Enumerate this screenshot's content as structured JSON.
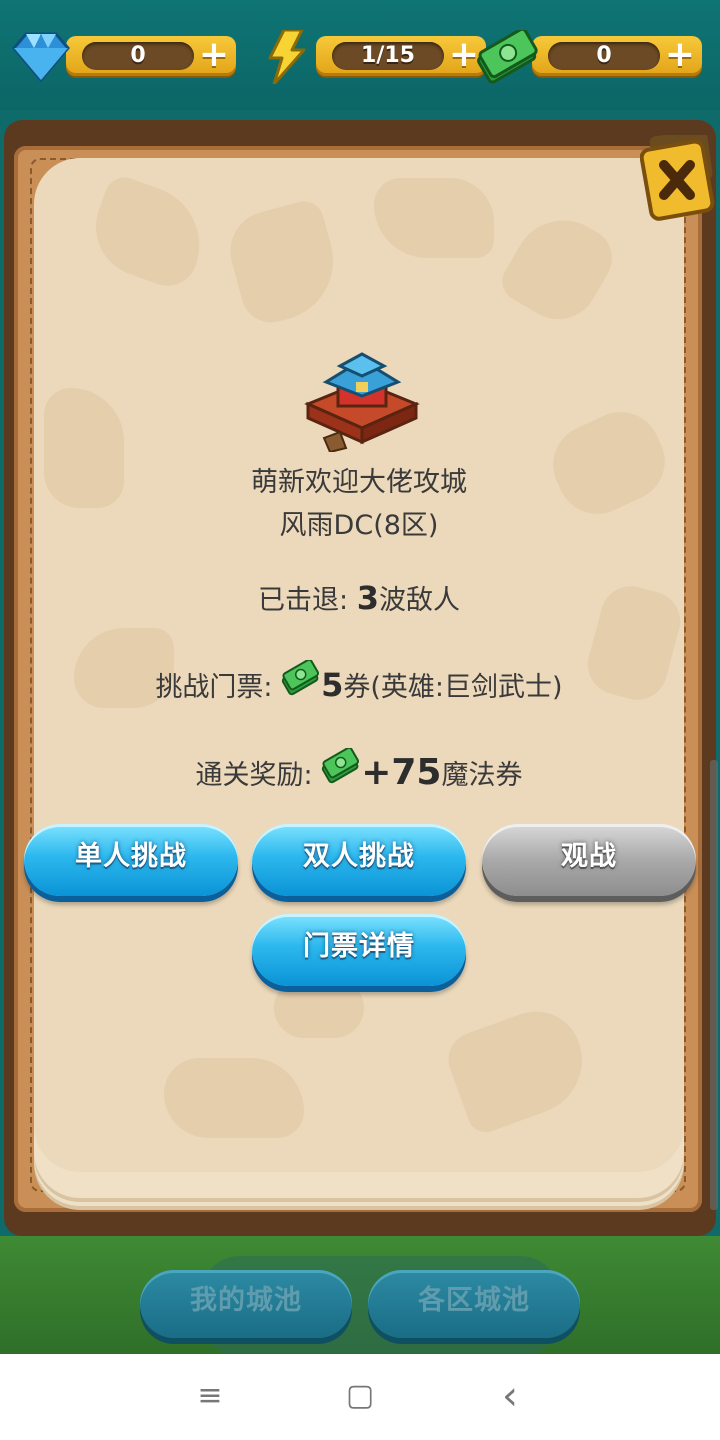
{
  "resources": {
    "diamonds": {
      "value": "0",
      "icon": "diamond-icon"
    },
    "energy": {
      "value": "1/15",
      "icon": "lightning-icon"
    },
    "cash": {
      "value": "0",
      "icon": "cash-icon"
    },
    "plus_label": "+"
  },
  "dialog": {
    "title": "萌新欢迎大佬攻城",
    "subtitle": "风雨DC(8区)",
    "repelled": {
      "label": "已击退: ",
      "value": "3",
      "suffix": "波敌人"
    },
    "ticket": {
      "label": "挑战门票: ",
      "value": "5",
      "suffix": "券(英雄:巨剑武士)"
    },
    "reward": {
      "label": "通关奖励: ",
      "value": "+75",
      "suffix": "魔法券"
    },
    "buttons": {
      "single": "单人挑战",
      "double": "双人挑战",
      "watch": "观战",
      "ticket_details": "门票详情"
    }
  },
  "bottom": {
    "my_city": "我的城池",
    "all_cities": "各区城池"
  },
  "navbar": {
    "menu": "≡",
    "home": "▢",
    "back": "‹"
  },
  "colors": {
    "button_blue": "#2cb8ee",
    "button_gray": "#a9a9a9",
    "paper": "#ecd9bb",
    "frame": "#c98f57",
    "topbar": "#0f7474"
  }
}
